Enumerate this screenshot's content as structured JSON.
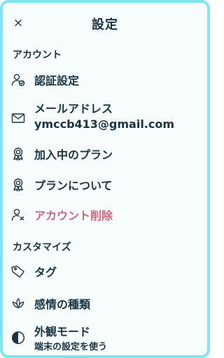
{
  "header": {
    "close_icon": "×",
    "title": "設定"
  },
  "sections": {
    "account": {
      "title": "アカウント",
      "items": [
        {
          "label": "認証設定",
          "icon": "user-check-icon"
        },
        {
          "label": "メールアドレス",
          "value": "ymccb413@gmail.com",
          "icon": "mail-icon"
        },
        {
          "label": "加入中のプラン",
          "icon": "award-icon"
        },
        {
          "label": "プランについて",
          "icon": "award-icon"
        },
        {
          "label": "アカウント削除",
          "icon": "user-x-icon",
          "color": "#d0657d"
        }
      ]
    },
    "customize": {
      "title": "カスタマイズ",
      "items": [
        {
          "label": "タグ",
          "icon": "tag-icon"
        },
        {
          "label": "感情の種類",
          "icon": "lotus-icon"
        },
        {
          "label": "外観モード",
          "value": "端末の設定を使う",
          "icon": "contrast-icon"
        }
      ]
    }
  },
  "colors": {
    "text": "#1b3442",
    "danger": "#d0657d",
    "border": "#7ee6ef",
    "background": "#f7fdfd"
  }
}
